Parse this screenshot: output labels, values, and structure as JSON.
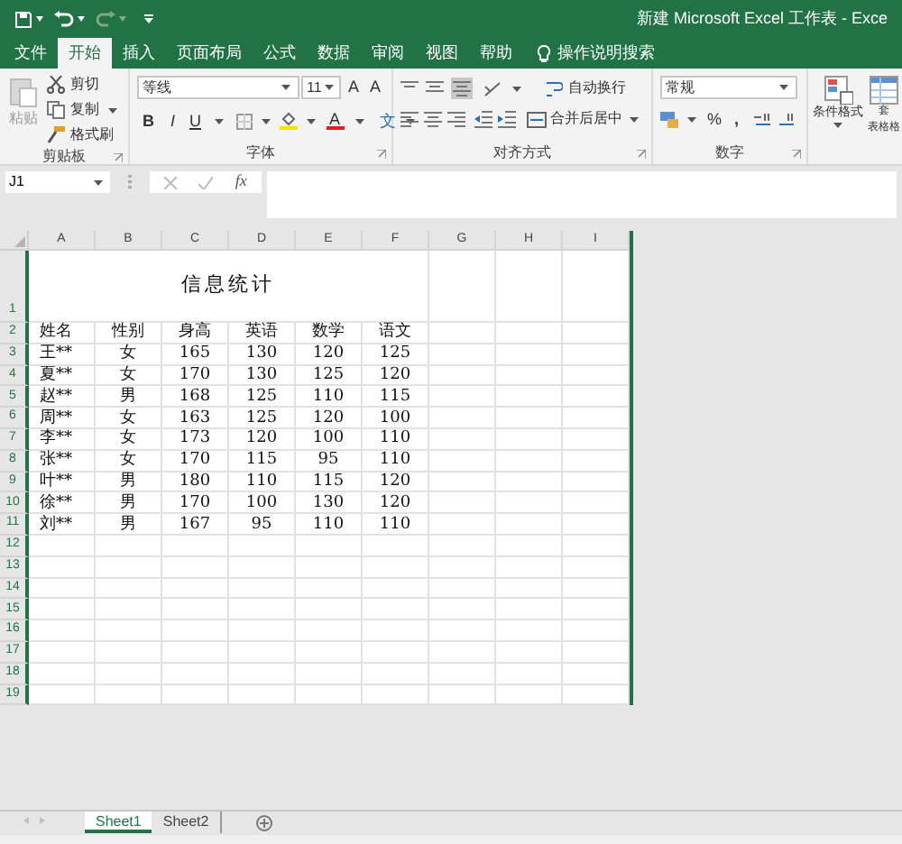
{
  "window": {
    "title": "新建 Microsoft Excel 工作表 - Exce"
  },
  "quick_access": [
    {
      "kind": "save",
      "disabled": false
    },
    {
      "kind": "undo",
      "disabled": false
    },
    {
      "kind": "redo",
      "disabled": true
    },
    {
      "kind": "customize",
      "disabled": false
    }
  ],
  "tabs": [
    {
      "label": "文件",
      "selected": false
    },
    {
      "label": "开始",
      "selected": true
    },
    {
      "label": "插入",
      "selected": false
    },
    {
      "label": "页面布局",
      "selected": false
    },
    {
      "label": "公式",
      "selected": false
    },
    {
      "label": "数据",
      "selected": false
    },
    {
      "label": "审阅",
      "selected": false
    },
    {
      "label": "视图",
      "selected": false
    },
    {
      "label": "帮助",
      "selected": false
    }
  ],
  "tell_me": {
    "placeholder": "操作说明搜索"
  },
  "ribbon": {
    "clipboard": {
      "paste": {
        "label": "粘贴",
        "disabled": true
      },
      "cut": "剪切",
      "copy": "复制",
      "format_painter": "格式刷",
      "label": "剪贴板"
    },
    "font": {
      "name": "等线",
      "size": "11",
      "grow": "A",
      "shrink": "A",
      "bold": "B",
      "italic": "I",
      "underline": "U",
      "color_letter": "A",
      "phonetic": "文",
      "label": "字体"
    },
    "alignment": {
      "wrap": "自动换行",
      "merge": "合并后居中",
      "label": "对齐方式"
    },
    "number": {
      "format": "常规",
      "percent": "%",
      "comma": ",",
      "label": "数字"
    },
    "styles": {
      "conditional": "条件格式",
      "table_line_1": "套",
      "table_line_2": "表格格"
    }
  },
  "name_box": "J1",
  "formula_bar": {
    "fx": "fx"
  },
  "sheet": {
    "columns": [
      "A",
      "B",
      "C",
      "D",
      "E",
      "F",
      "G",
      "H",
      "I"
    ],
    "row_numbers": [
      "1",
      "2",
      "3",
      "4",
      "5",
      "6",
      "7",
      "8",
      "9",
      "10",
      "11",
      "12",
      "13",
      "14",
      "15",
      "16",
      "17",
      "18",
      "19"
    ],
    "title": "信息统计",
    "header": [
      "姓名",
      "性别",
      "身高",
      "英语",
      "数学",
      "语文"
    ],
    "data": [
      [
        "王**",
        "女",
        "165",
        "130",
        "120",
        "125"
      ],
      [
        "夏**",
        "女",
        "170",
        "130",
        "125",
        "120"
      ],
      [
        "赵**",
        "男",
        "168",
        "125",
        "110",
        "115"
      ],
      [
        "周**",
        "女",
        "163",
        "125",
        "120",
        "100"
      ],
      [
        "李**",
        "女",
        "173",
        "120",
        "100",
        "110"
      ],
      [
        "张**",
        "女",
        "170",
        "115",
        "95",
        "110"
      ],
      [
        "叶**",
        "男",
        "180",
        "110",
        "115",
        "120"
      ],
      [
        "徐**",
        "男",
        "170",
        "100",
        "130",
        "120"
      ],
      [
        "刘**",
        "男",
        "167",
        "95",
        "110",
        "110"
      ]
    ]
  },
  "sheet_tabs": [
    {
      "label": "Sheet1",
      "selected": true
    },
    {
      "label": "Sheet2",
      "selected": false
    }
  ]
}
